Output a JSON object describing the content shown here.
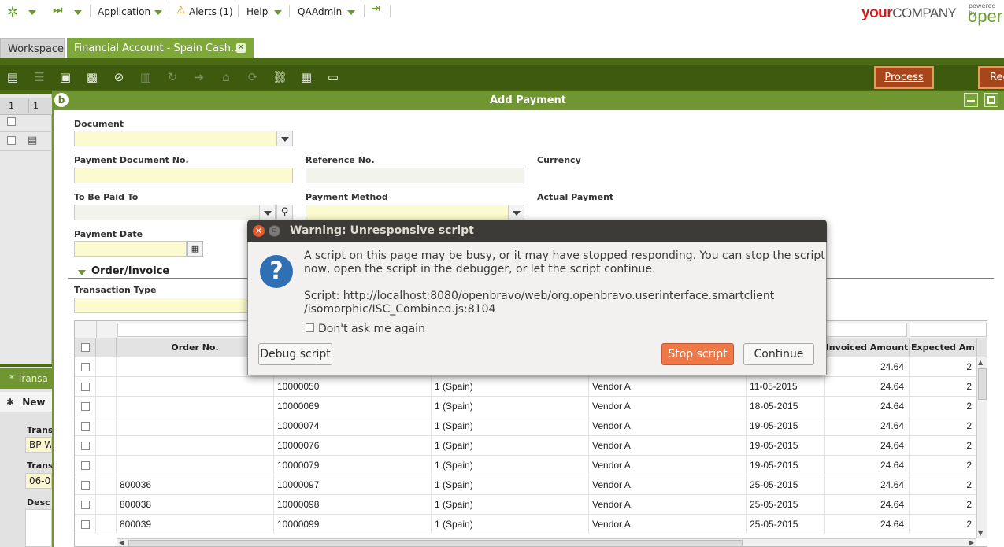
{
  "topbar": {
    "application_label": "Application",
    "alerts_label": "Alerts (1)",
    "help_label": "Help",
    "user_label": "QAAdmin",
    "logo_your": "your",
    "logo_company": "COMPANY",
    "powered_by": "powered by",
    "openbravo_partial": "oper"
  },
  "tabs": {
    "workspace": "Workspace",
    "financial_account": "Financial Account - Spain Cash...",
    "close_glyph": "✕"
  },
  "toolbar": {
    "process_label": "Process",
    "rec_partial": "Rec"
  },
  "left_panel": {
    "grid_header_a": "1",
    "grid_header_b": "1",
    "subtab_label": "* Transa",
    "new_label": "New",
    "label_trans1": "Trans",
    "value_trans1": "BP W",
    "label_trans2": "Trans",
    "value_trans2": "06-0",
    "label_desc": "Desc"
  },
  "add_payment": {
    "title": "Add Payment",
    "labels": {
      "document": "Document",
      "payment_document_no": "Payment Document No.",
      "reference_no": "Reference No.",
      "currency": "Currency",
      "to_be_paid_to": "To Be Paid To",
      "payment_method": "Payment Method",
      "actual_payment": "Actual Payment",
      "payment_date": "Payment Date",
      "transaction_type": "Transaction Type"
    },
    "section_title": "Order/Invoice",
    "columns": {
      "order_no": "Order No.",
      "invoiced_amount": "Invoiced Amount",
      "expected_amount_partial": "Expected Am"
    },
    "rows": [
      {
        "order": "",
        "invoice": "",
        "org": "",
        "bp": "",
        "date": "",
        "invoiced": "24.64",
        "expected": "2"
      },
      {
        "order": "",
        "invoice": "10000050",
        "org": "1 (Spain)",
        "bp": "Vendor A",
        "date": "11-05-2015",
        "invoiced": "24.64",
        "expected": "2"
      },
      {
        "order": "",
        "invoice": "10000069",
        "org": "1 (Spain)",
        "bp": "Vendor A",
        "date": "18-05-2015",
        "invoiced": "24.64",
        "expected": "2"
      },
      {
        "order": "",
        "invoice": "10000074",
        "org": "1 (Spain)",
        "bp": "Vendor A",
        "date": "19-05-2015",
        "invoiced": "24.64",
        "expected": "2"
      },
      {
        "order": "",
        "invoice": "10000076",
        "org": "1 (Spain)",
        "bp": "Vendor A",
        "date": "19-05-2015",
        "invoiced": "24.64",
        "expected": "2"
      },
      {
        "order": "",
        "invoice": "10000079",
        "org": "1 (Spain)",
        "bp": "Vendor A",
        "date": "19-05-2015",
        "invoiced": "24.64",
        "expected": "2"
      },
      {
        "order": "800036",
        "invoice": "10000097",
        "org": "1 (Spain)",
        "bp": "Vendor A",
        "date": "25-05-2015",
        "invoiced": "24.64",
        "expected": "2"
      },
      {
        "order": "800038",
        "invoice": "10000098",
        "org": "1 (Spain)",
        "bp": "Vendor A",
        "date": "25-05-2015",
        "invoiced": "24.64",
        "expected": "2"
      },
      {
        "order": "800039",
        "invoice": "10000099",
        "org": "1 (Spain)",
        "bp": "Vendor A",
        "date": "25-05-2015",
        "invoiced": "24.64",
        "expected": "2"
      }
    ]
  },
  "dialog": {
    "title": "Warning: Unresponsive script",
    "message_line1": "A script on this page may be busy, or it may have stopped responding. You can stop the script",
    "message_line2": "now, open the script in the debugger, or let the script continue.",
    "script_line1": "Script: http://localhost:8080/openbravo/web/org.openbravo.userinterface.smartclient",
    "script_line2": "/isomorphic/ISC_Combined.js:8104",
    "dont_ask_label": "Don't ask me again",
    "debug_button": "Debug script",
    "stop_button": "Stop script",
    "continue_button": "Continue"
  },
  "colors": {
    "brand_green": "#6f9630",
    "toolbar_dark_green": "#3e5a0f",
    "process_button": "#a7461a",
    "stop_button": "#f07746",
    "field_yellow": "#fbfbcf",
    "logo_red": "#cc1d1d"
  }
}
